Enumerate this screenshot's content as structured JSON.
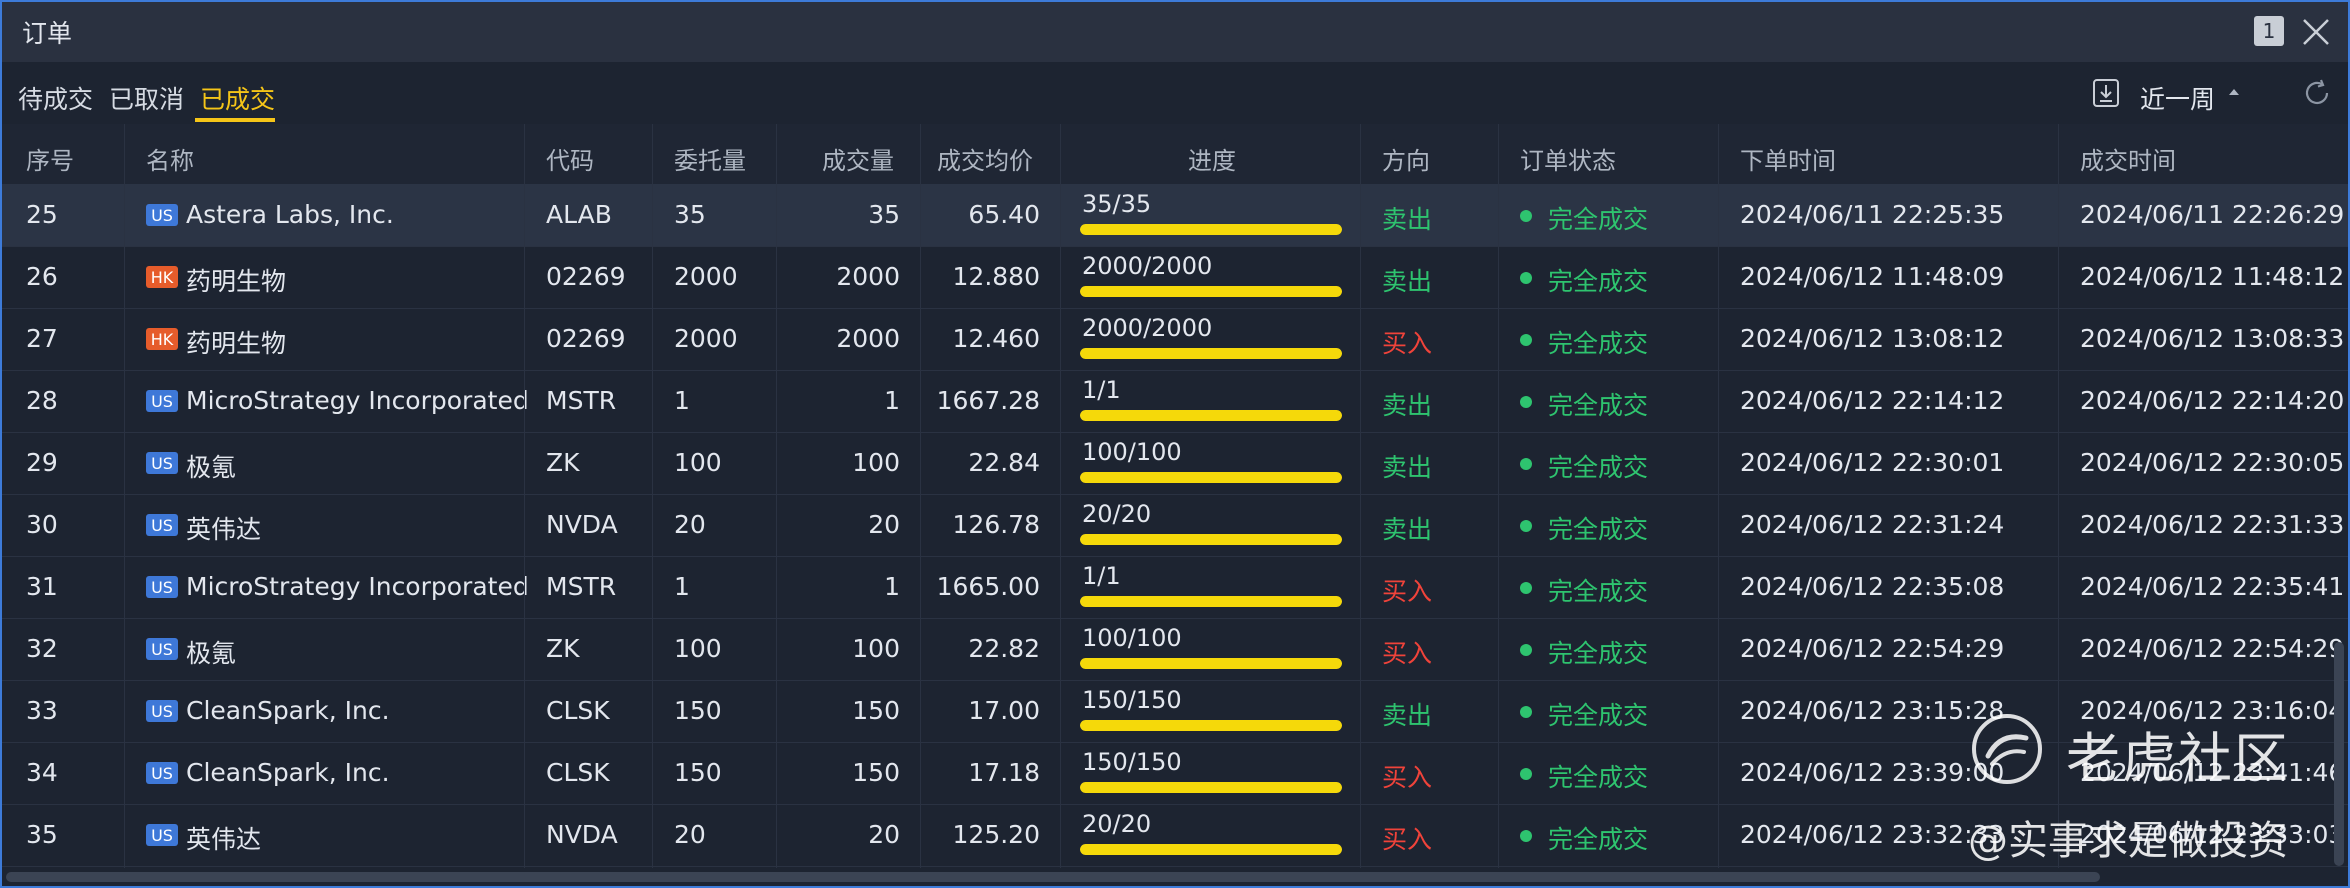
{
  "window": {
    "title": "订单",
    "badge": "1"
  },
  "tabs": [
    "待成交",
    "已取消",
    "已成交"
  ],
  "active_tab": "已成交",
  "filter": {
    "period": "近一周"
  },
  "columns": {
    "seq": "序号",
    "name": "名称",
    "code": "代码",
    "order_qty": "委托量",
    "filled_qty": "成交量",
    "avg_price": "成交均价",
    "progress": "进度",
    "direction": "方向",
    "status": "订单状态",
    "order_time": "下单时间",
    "fill_time": "成交时间"
  },
  "rows": [
    {
      "seq": "25",
      "market": "US",
      "name": "Astera Labs, Inc.",
      "code": "ALAB",
      "order_qty": "35",
      "filled_qty": "35",
      "avg_price": "65.40",
      "progress_text": "35/35",
      "progress": 1.0,
      "direction": "卖出",
      "side": "sell",
      "status": "完全成交",
      "order_time": "2024/06/11 22:25:35",
      "fill_time": "2024/06/11 22:26:29"
    },
    {
      "seq": "26",
      "market": "HK",
      "name": "药明生物",
      "code": "02269",
      "order_qty": "2000",
      "filled_qty": "2000",
      "avg_price": "12.880",
      "progress_text": "2000/2000",
      "progress": 1.0,
      "direction": "卖出",
      "side": "sell",
      "status": "完全成交",
      "order_time": "2024/06/12 11:48:09",
      "fill_time": "2024/06/12 11:48:12"
    },
    {
      "seq": "27",
      "market": "HK",
      "name": "药明生物",
      "code": "02269",
      "order_qty": "2000",
      "filled_qty": "2000",
      "avg_price": "12.460",
      "progress_text": "2000/2000",
      "progress": 1.0,
      "direction": "买入",
      "side": "buy",
      "status": "完全成交",
      "order_time": "2024/06/12 13:08:12",
      "fill_time": "2024/06/12 13:08:33"
    },
    {
      "seq": "28",
      "market": "US",
      "name": "MicroStrategy Incorporated",
      "code": "MSTR",
      "order_qty": "1",
      "filled_qty": "1",
      "avg_price": "1667.28",
      "progress_text": "1/1",
      "progress": 1.0,
      "direction": "卖出",
      "side": "sell",
      "status": "完全成交",
      "order_time": "2024/06/12 22:14:12",
      "fill_time": "2024/06/12 22:14:20"
    },
    {
      "seq": "29",
      "market": "US",
      "name": "极氪",
      "code": "ZK",
      "order_qty": "100",
      "filled_qty": "100",
      "avg_price": "22.84",
      "progress_text": "100/100",
      "progress": 1.0,
      "direction": "卖出",
      "side": "sell",
      "status": "完全成交",
      "order_time": "2024/06/12 22:30:01",
      "fill_time": "2024/06/12 22:30:05"
    },
    {
      "seq": "30",
      "market": "US",
      "name": "英伟达",
      "code": "NVDA",
      "order_qty": "20",
      "filled_qty": "20",
      "avg_price": "126.78",
      "progress_text": "20/20",
      "progress": 1.0,
      "direction": "卖出",
      "side": "sell",
      "status": "完全成交",
      "order_time": "2024/06/12 22:31:24",
      "fill_time": "2024/06/12 22:31:33"
    },
    {
      "seq": "31",
      "market": "US",
      "name": "MicroStrategy Incorporated",
      "code": "MSTR",
      "order_qty": "1",
      "filled_qty": "1",
      "avg_price": "1665.00",
      "progress_text": "1/1",
      "progress": 1.0,
      "direction": "买入",
      "side": "buy",
      "status": "完全成交",
      "order_time": "2024/06/12 22:35:08",
      "fill_time": "2024/06/12 22:35:41"
    },
    {
      "seq": "32",
      "market": "US",
      "name": "极氪",
      "code": "ZK",
      "order_qty": "100",
      "filled_qty": "100",
      "avg_price": "22.82",
      "progress_text": "100/100",
      "progress": 1.0,
      "direction": "买入",
      "side": "buy",
      "status": "完全成交",
      "order_time": "2024/06/12 22:54:29",
      "fill_time": "2024/06/12 22:54:29"
    },
    {
      "seq": "33",
      "market": "US",
      "name": "CleanSpark, Inc.",
      "code": "CLSK",
      "order_qty": "150",
      "filled_qty": "150",
      "avg_price": "17.00",
      "progress_text": "150/150",
      "progress": 1.0,
      "direction": "卖出",
      "side": "sell",
      "status": "完全成交",
      "order_time": "2024/06/12 23:15:28",
      "fill_time": "2024/06/12 23:16:04"
    },
    {
      "seq": "34",
      "market": "US",
      "name": "CleanSpark, Inc.",
      "code": "CLSK",
      "order_qty": "150",
      "filled_qty": "150",
      "avg_price": "17.18",
      "progress_text": "150/150",
      "progress": 1.0,
      "direction": "买入",
      "side": "buy",
      "status": "完全成交",
      "order_time": "2024/06/12 23:39:00",
      "fill_time": "2024/06/12 23:41:46"
    },
    {
      "seq": "35",
      "market": "US",
      "name": "英伟达",
      "code": "NVDA",
      "order_qty": "20",
      "filled_qty": "20",
      "avg_price": "125.20",
      "progress_text": "20/20",
      "progress": 1.0,
      "direction": "买入",
      "side": "buy",
      "status": "完全成交",
      "order_time": "2024/06/12 23:32:33",
      "fill_time": "2024/06/12 23:33:03"
    }
  ],
  "watermark": {
    "line1": "老虎社区",
    "line2": "@实事求是做投资"
  },
  "colors": {
    "accent": "#f5c518",
    "sell": "#2ec46f",
    "buy": "#f0433a",
    "progress": "#f5d90a",
    "us_badge": "#3e78d8",
    "hk_badge": "#e65c2b"
  }
}
